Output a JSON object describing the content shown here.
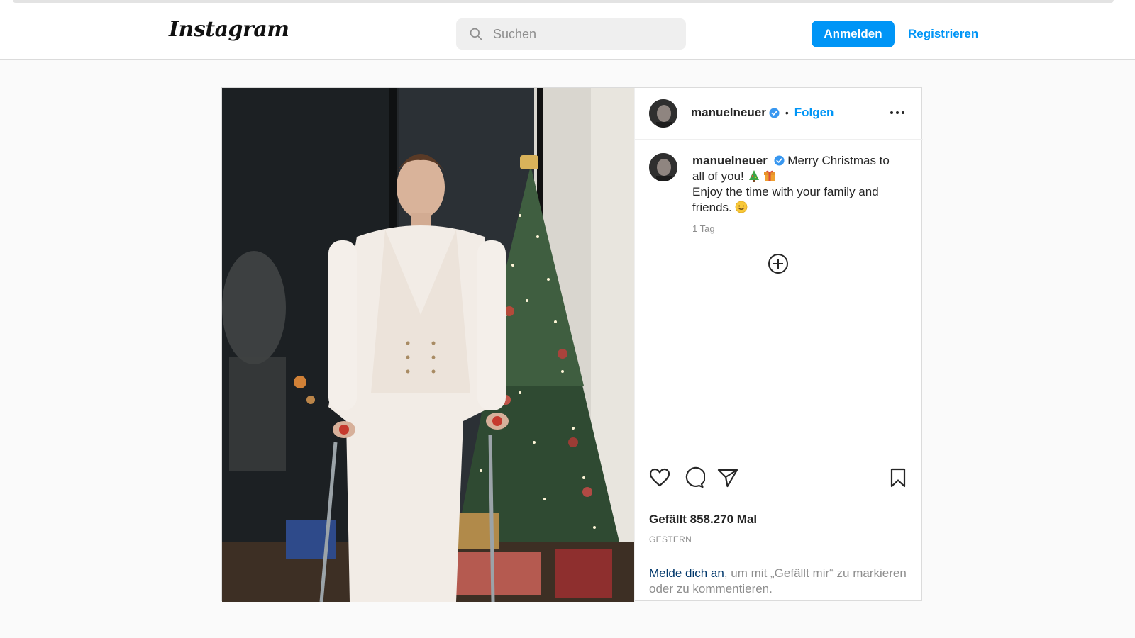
{
  "header": {
    "logo": "Instagram",
    "search_placeholder": "Suchen",
    "login_label": "Anmelden",
    "register_label": "Registrieren"
  },
  "post": {
    "username": "manuelneuer",
    "follow_label": "Folgen",
    "separator": "•",
    "caption_line1": "Merry Christmas to all of you!",
    "caption_line2": "Enjoy the time with your family and friends.",
    "time_ago": "1 Tag",
    "likes_text": "Gefällt 858.270 Mal",
    "date_label": "GESTERN",
    "login_prompt_link": "Melde dich an",
    "login_prompt_rest": ", um mit „Gefällt mir“ zu markieren oder zu kommentieren."
  },
  "colors": {
    "accent": "#0095f6",
    "link_dark": "#00376b",
    "muted": "#8e8e8e",
    "text": "#262626"
  },
  "icons": [
    "search-icon",
    "verified-icon",
    "more-icon",
    "add-comment-icon",
    "heart-icon",
    "comment-icon",
    "share-icon",
    "bookmark-icon",
    "tree-emoji",
    "gift-emoji",
    "smile-emoji"
  ]
}
